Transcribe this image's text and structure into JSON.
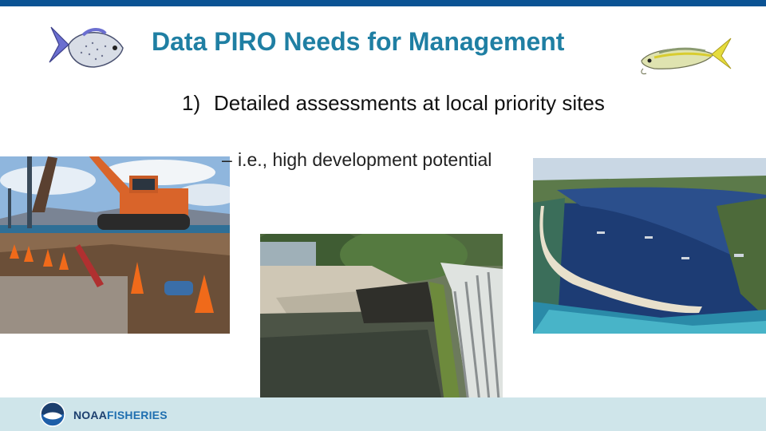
{
  "slide": {
    "title": "Data PIRO Needs for Management",
    "bullet_number": "1)",
    "bullet_text": "Detailed assessments at local priority sites",
    "sub_bullet": "i.e., high development potential"
  },
  "footer": {
    "logo_text_1": "NOAA",
    "logo_text_2": "FISHERIES"
  },
  "colors": {
    "top_bar": "#0b5394",
    "title": "#1f7fa3",
    "footer_band": "#cfe5ea"
  },
  "images": {
    "left_photo": "construction-excavator-photo",
    "center_photo": "shoreline-seawall-photo",
    "right_photo": "aerial-harbor-photo",
    "left_fish": "trevally-fish-illustration",
    "right_fish": "mackerel-fish-illustration"
  }
}
